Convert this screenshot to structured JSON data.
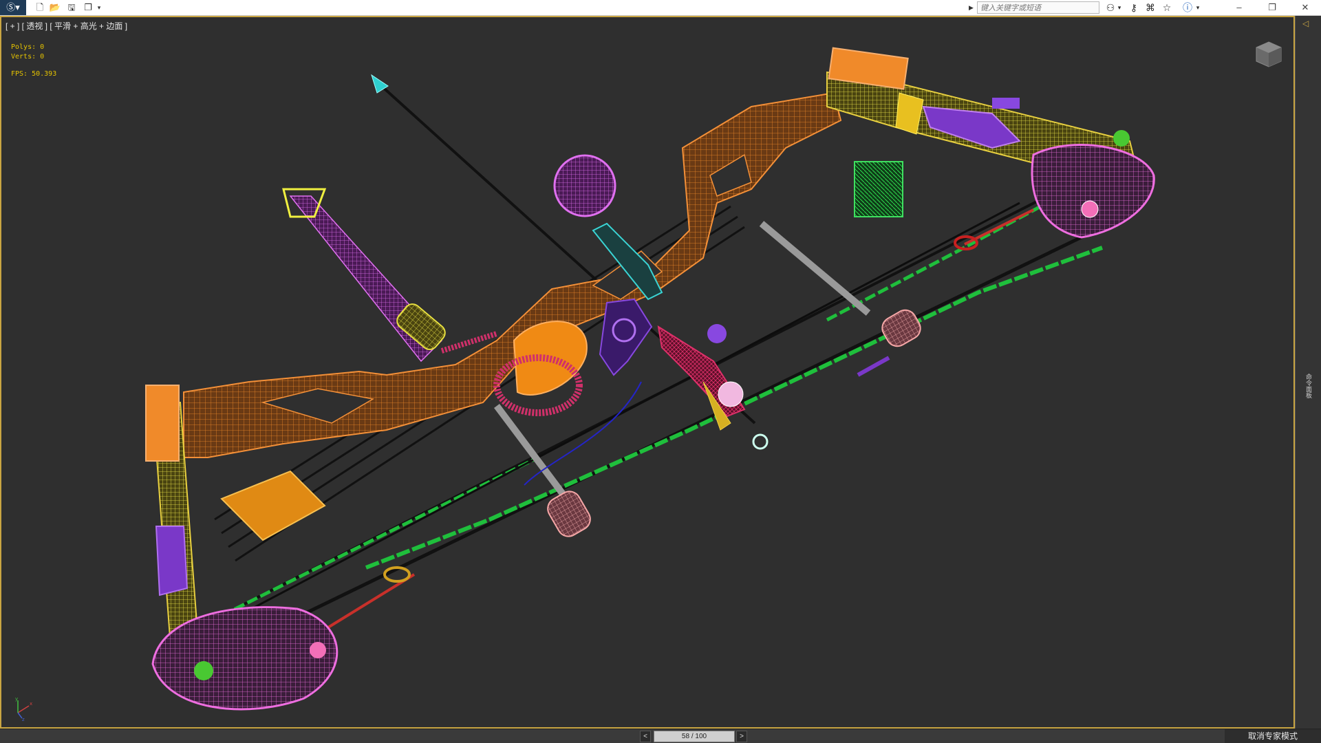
{
  "titlebar": {
    "search_placeholder": "键入关键字或短语",
    "quick_access_icons": [
      "new-file-icon",
      "open-folder-icon",
      "save-icon",
      "project-icon",
      "dropdown-icon"
    ],
    "toolbar_icons": [
      "binoculars-icon",
      "key-icon",
      "user-icon",
      "star-icon",
      "help-icon"
    ],
    "window_controls": [
      "minimize-icon",
      "restore-icon",
      "close-icon"
    ]
  },
  "viewport": {
    "label": "[ + ] [ 透视 ] [ 平滑 + 高光 + 边面 ]",
    "stats": {
      "polys": "Polys: 0",
      "verts": "Verts: 0",
      "fps": "FPS:   50.393"
    },
    "axis_labels": {
      "x": "x",
      "y": "y",
      "z": "z"
    }
  },
  "right_panel": {
    "label": "命令面板"
  },
  "bottombar": {
    "prev": "<",
    "next": ">",
    "frame": "58 / 100",
    "expert_button": "取消专家模式"
  },
  "colors": {
    "viewport_bg": "#2f2f2f",
    "active_border": "#c9a542",
    "limb_orange": "#e87a1e",
    "cam_pink": "#e46ad6",
    "string_green": "#1fbf3c",
    "sight_magenta": "#d65ae6",
    "yellow": "#e8e040",
    "red": "#c8302a",
    "purple": "#7a38c8",
    "cyan": "#33d6d6"
  }
}
